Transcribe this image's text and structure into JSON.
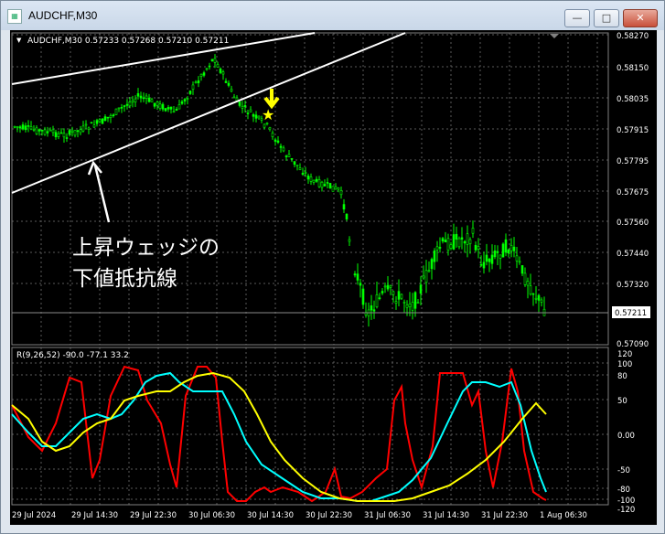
{
  "window": {
    "title": "AUDCHF,M30",
    "buttons": {
      "minimize": "—",
      "maximize": "□",
      "close": "✕"
    }
  },
  "main_chart": {
    "header": "AUDCHF,M30  0.57233 0.57268 0.57210 0.57211",
    "price_labels": [
      "0.58270",
      "0.58150",
      "0.58035",
      "0.57915",
      "0.57795",
      "0.57675",
      "0.57560",
      "0.57440",
      "0.57320",
      "0.57090"
    ],
    "current_price": "0.57211",
    "annotation_line1": "上昇ウェッジの",
    "annotation_line2": "下値抵抗線"
  },
  "indicator": {
    "header": "R(9,26,52) -90.0 -77.1 33.2",
    "scale_labels": [
      "120",
      "100",
      "80",
      "50",
      "0.00",
      "-50",
      "-80",
      "-100",
      "-120"
    ]
  },
  "time_labels": [
    "29 Jul 2024",
    "29 Jul 14:30",
    "29 Jul 22:30",
    "30 Jul 06:30",
    "30 Jul 14:30",
    "30 Jul 22:30",
    "31 Jul 06:30",
    "31 Jul 14:30",
    "31 Jul 22:30",
    "1 Aug 06:30"
  ],
  "colors": {
    "background": "#000000",
    "candles": "#00ff00",
    "trendlines": "#ffffff",
    "arrow": "#ffff00",
    "indicator_fast": "#ff0000",
    "indicator_mid": "#00ffff",
    "indicator_slow": "#ffff00"
  }
}
